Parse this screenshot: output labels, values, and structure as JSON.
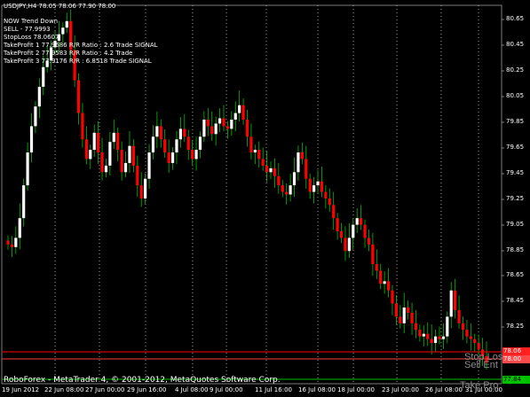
{
  "header": {
    "symbol_line": "USDJPY,H4  78.05 78.06 77.90 78.00"
  },
  "info_lines": [
    "NOW Trend  Down",
    "SELL - 77.9993",
    "StopLoss 78.0607",
    "TakeProfit 1 77.9686 R/R Ratio : 2.6  Trade SIGNAL",
    "TakeProfit 2 77.9583 R/R Ratio : 4.2 Trade",
    "TakeProfit 3 77.9176 R/R : 6.8518 Trade SIGNAL"
  ],
  "price_axis": {
    "labels": [
      "80.65",
      "80.45",
      "80.25",
      "80.05",
      "79.85",
      "79.65",
      "79.45",
      "79.25",
      "79.05",
      "78.85",
      "78.65",
      "78.45",
      "78.25"
    ]
  },
  "time_axis": {
    "labels": [
      "19 Jun 2012",
      "22 Jun 08:00",
      "27 Jun 00:00",
      "29 Jun 16:00",
      "4 Jul 08:00",
      "9 Jul 00:00",
      "11 Jul 16:00",
      "16 Jul 08:00",
      "18 Jul 00:00",
      "23 Jul 00:00",
      "26 Jul 08:00",
      "31 Jul 00:00"
    ]
  },
  "price_boxes": {
    "stop": "78.06",
    "entry": "78.00",
    "take": "77.84"
  },
  "line_labels": {
    "stop": "Stop Los",
    "entry": "Sell Ent",
    "take": "Take Pro"
  },
  "footer": {
    "copyright": "RoboForex - MetaTrader 4, © 2001-2012, MetaQuotes Software Corp."
  },
  "colors": {
    "background": "#000000",
    "bull_candle": "#ffffff",
    "bear_candle": "#ff0000",
    "wick": "#00c000",
    "stop_line": "#ff0000",
    "entry_line": "#ff3b3b",
    "take_line": "#00c000",
    "separator": "#ffffff"
  },
  "chart_data": {
    "type": "candlestick",
    "symbol": "USDJPY",
    "timeframe": "H4",
    "ylim": [
      77.84,
      80.72
    ],
    "closes": [
      78.9,
      78.88,
      78.95,
      79.1,
      79.35,
      79.6,
      79.8,
      79.95,
      80.1,
      80.25,
      80.3,
      80.4,
      80.45,
      80.5,
      80.55,
      80.6,
      80.38,
      80.15,
      79.9,
      79.7,
      79.55,
      79.62,
      79.75,
      79.6,
      79.45,
      79.5,
      79.68,
      79.75,
      79.62,
      79.45,
      79.52,
      79.65,
      79.5,
      79.35,
      79.25,
      79.4,
      79.6,
      79.72,
      79.8,
      79.7,
      79.6,
      79.52,
      79.6,
      79.7,
      79.78,
      79.72,
      79.62,
      79.55,
      79.62,
      79.72,
      79.85,
      79.8,
      79.74,
      79.82,
      79.86,
      79.8,
      79.78,
      79.85,
      79.9,
      79.96,
      79.85,
      79.72,
      79.6,
      79.62,
      79.55,
      79.5,
      79.45,
      79.48,
      79.42,
      79.35,
      79.3,
      79.28,
      79.35,
      79.45,
      79.6,
      79.55,
      79.4,
      79.3,
      79.35,
      79.38,
      79.3,
      79.25,
      79.2,
      79.1,
      79.0,
      78.95,
      78.85,
      78.95,
      79.05,
      79.1,
      79.05,
      78.95,
      78.9,
      78.75,
      78.7,
      78.6,
      78.62,
      78.55,
      78.45,
      78.35,
      78.3,
      78.42,
      78.38,
      78.3,
      78.25,
      78.2,
      78.22,
      78.18,
      78.15,
      78.2,
      78.18,
      78.2,
      78.35,
      78.55,
      78.4,
      78.3,
      78.25,
      78.2,
      78.18,
      78.15,
      78.1,
      78.05,
      78.0
    ]
  }
}
